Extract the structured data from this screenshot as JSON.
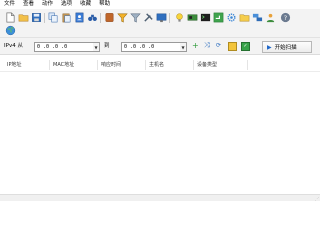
{
  "menu": [
    "文件",
    "查看",
    "动作",
    "选项",
    "收藏",
    "帮助"
  ],
  "toolbar": {
    "buttons": [
      "new-file-icon",
      "open-folder-icon",
      "save-icon",
      "copy-icon",
      "paste-icon",
      "address-book-icon",
      "binoculars-icon",
      "delete-icon",
      "filter-icon",
      "clear-filter-icon",
      "tools-icon",
      "monitor-icon",
      "bulb-icon",
      "network-card-icon",
      "terminal-icon",
      "remote-desktop-icon",
      "settings-gear-icon",
      "folder-icon",
      "network-computers-icon",
      "users-icon",
      "help-icon",
      "globe-icon"
    ]
  },
  "range": {
    "from_label": "IPv4 从",
    "from_value": "0 .0 .0 .0",
    "to_label": "到",
    "to_value": "0 .0 .0 .0",
    "scan_label": "开始扫描"
  },
  "grid": {
    "columns": [
      "IP地址",
      "MAC地址",
      "响应时间",
      "主机名",
      "设备类型"
    ]
  },
  "colors": {
    "toolbar_bg": "#f3f3f3",
    "accent": "#1e66c8"
  }
}
